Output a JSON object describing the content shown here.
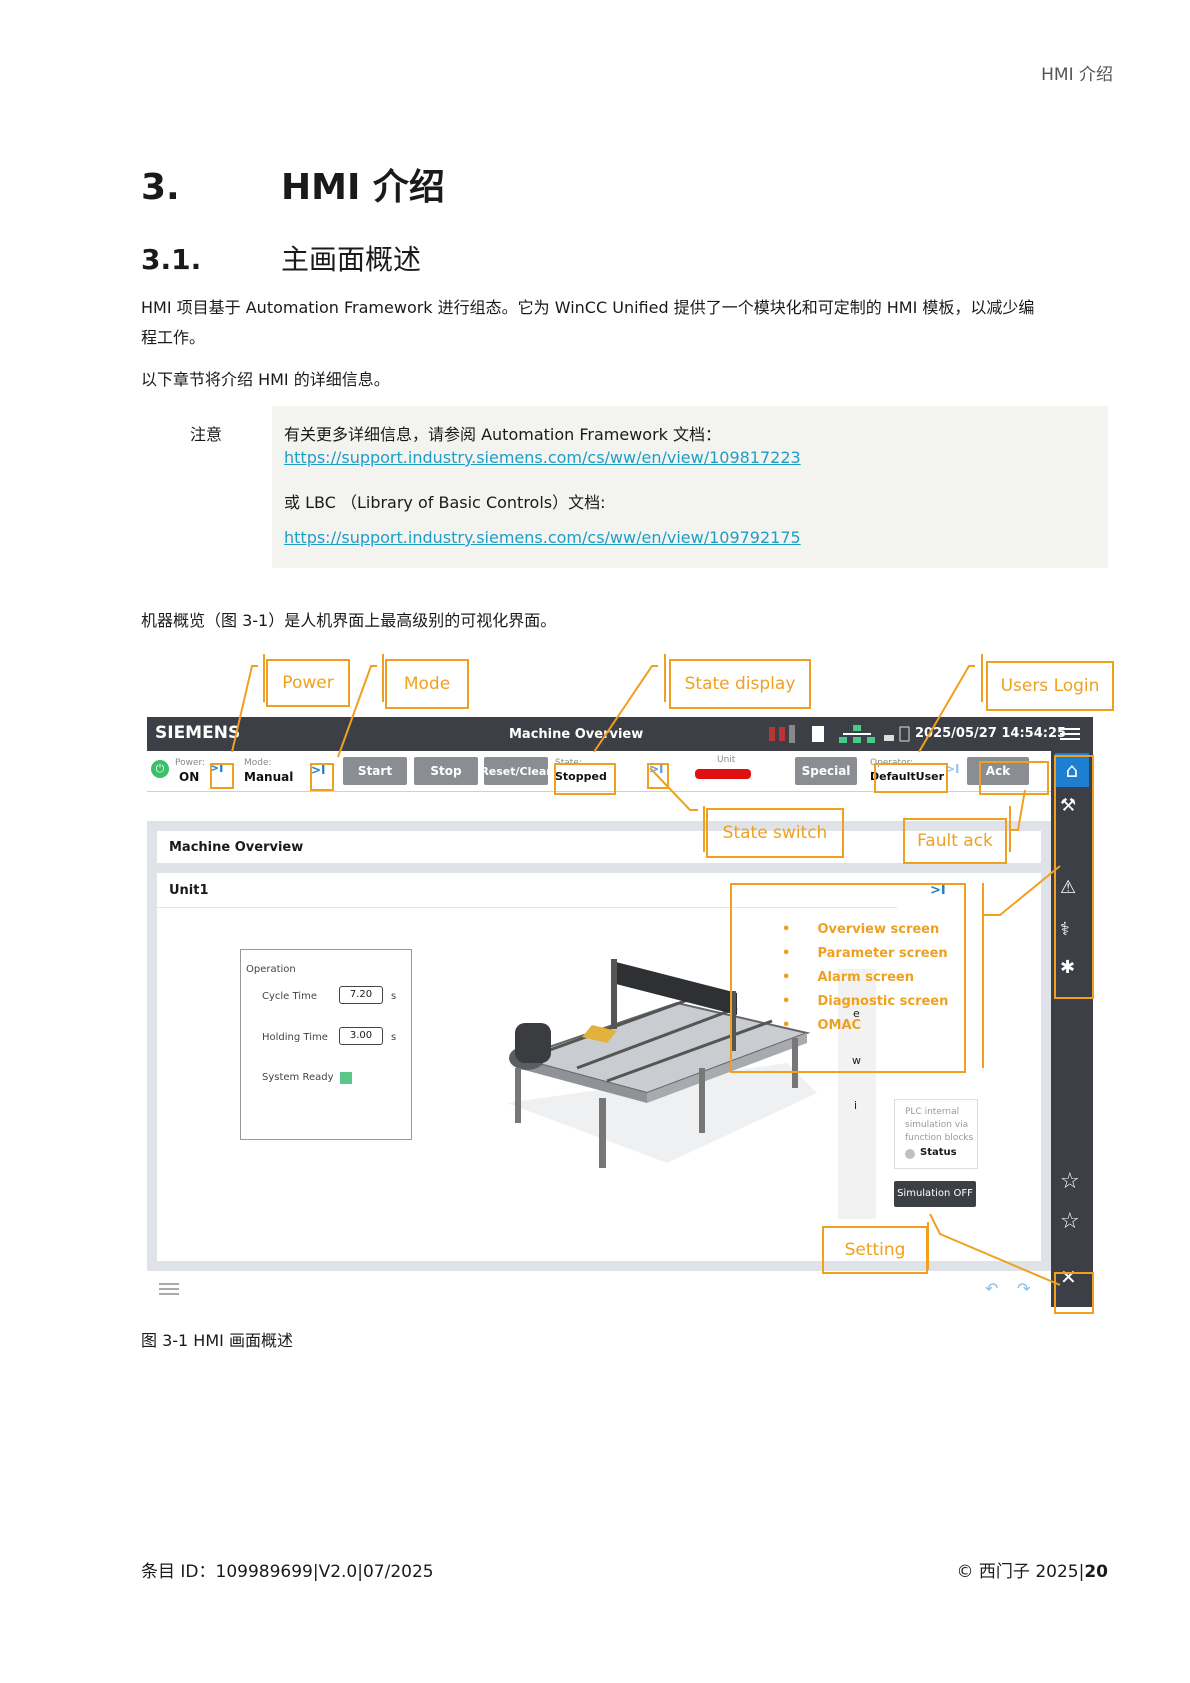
{
  "running_header": "HMI 介绍",
  "heading1": {
    "num": "3.",
    "title": "HMI 介绍"
  },
  "heading2": {
    "num": "3.1.",
    "title": "主画面概述"
  },
  "para1_line1": "HMI 项目基于 Automation Framework 进行组态。它为 WinCC Unified 提供了一个模块化和可定制的 HMI 模板，以减少编",
  "para1_line2": "程工作。",
  "para2": "以下章节将介绍 HMI 的详细信息。",
  "note": {
    "label": "注意",
    "line1": "有关更多详细信息，请参阅 Automation Framework 文档：",
    "link1": "https://support.industry.siemens.com/cs/ww/en/view/109817223",
    "line2": "或 LBC （Library of Basic Controls）文档:",
    "link2": "https://support.industry.siemens.com/cs/ww/en/view/109792175"
  },
  "para3": "机器概览（图 3-1）是人机界面上最高级别的可视化界面。",
  "annotations": {
    "power": "Power",
    "mode": "Mode",
    "state_display": "State display",
    "users_login": "Users Login",
    "state_switch": "State switch",
    "fault_ack": "Fault ack",
    "setting": "Setting"
  },
  "hmi": {
    "brand": "SIEMENS",
    "title": "Machine Overview",
    "datetime": "2025/05/27  14:54:25",
    "power_label": "Power:",
    "power_value": "ON",
    "mode_label": "Mode:",
    "mode_value": "Manual",
    "btn_start": "Start",
    "btn_stop": "Stop",
    "btn_reset": "Reset/Clear",
    "state_label": "State:",
    "state_value": "Stopped",
    "unit_label": "Unit",
    "btn_special": "Special",
    "operator_label": "Operator:",
    "operator_value": "DefaultUser",
    "btn_ack": "Ack",
    "panel_title": "Machine Overview",
    "unit_title": "Unit1",
    "operation": {
      "title": "Operation",
      "cycle_label": "Cycle Time",
      "cycle_value": "7.20",
      "cycle_unit": "s",
      "holding_label": "Holding Time",
      "holding_value": "3.00",
      "holding_unit": "s",
      "ready_label": "System Ready"
    },
    "menu": [
      "Overview screen",
      "Parameter screen",
      "Alarm screen",
      "Diagnostic screen",
      "OMAC"
    ],
    "side_letters": [
      "e",
      "w",
      "i"
    ],
    "sim_text": "PLC internal simulation via function blocks",
    "sim_status": "Status",
    "sim_button": "Simulation OFF",
    "ready_color": "#5cc58a",
    "unit_bar_color": "#e01010"
  },
  "figure_caption": "图 3-1 HMI 画面概述",
  "footer_left": "条目 ID：109989699|V2.0|07/2025",
  "footer_right_prefix": "© 西门子 2025|",
  "footer_page": "20"
}
